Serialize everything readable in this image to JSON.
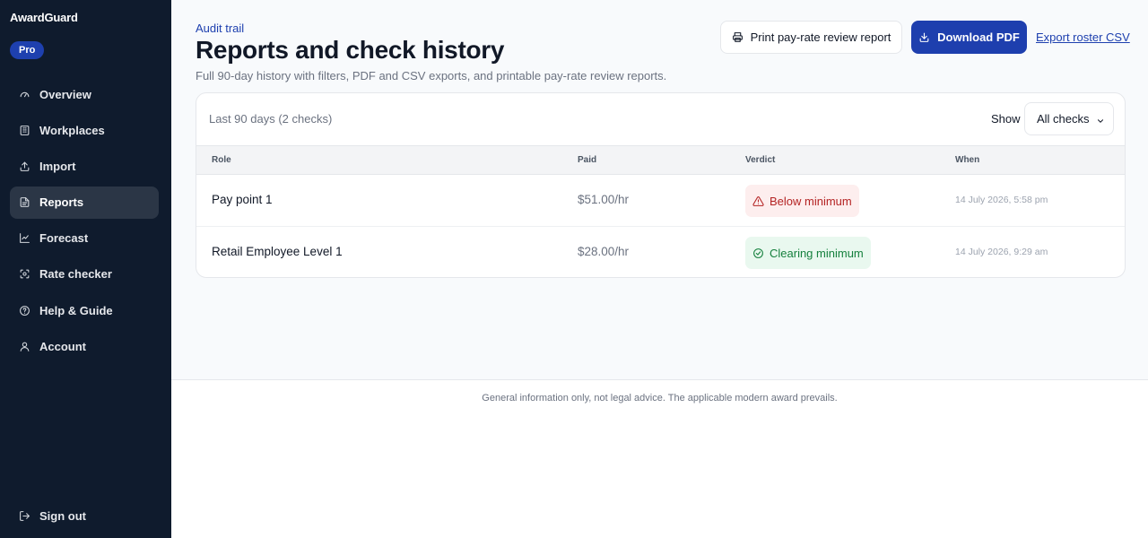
{
  "app": {
    "brand": "AwardGuard",
    "plan": "Pro"
  },
  "sidebar": {
    "items": [
      {
        "label": "Overview",
        "icon": "gauge-icon",
        "active": false
      },
      {
        "label": "Workplaces",
        "icon": "building-icon",
        "active": false
      },
      {
        "label": "Import",
        "icon": "upload-icon",
        "active": false
      },
      {
        "label": "Reports",
        "icon": "document-icon",
        "active": true
      },
      {
        "label": "Forecast",
        "icon": "line-chart-icon",
        "active": false
      },
      {
        "label": "Rate checker",
        "icon": "scan-icon",
        "active": false
      },
      {
        "label": "Help & Guide",
        "icon": "help-circle-icon",
        "active": false
      },
      {
        "label": "Account",
        "icon": "user-icon",
        "active": false
      }
    ],
    "sign_out": "Sign out"
  },
  "header": {
    "eyebrow": "Audit trail",
    "title": "Reports and check history",
    "subtitle": "Full 90-day history with filters, PDF and CSV exports, and printable pay-rate review reports.",
    "print_label": "Print pay-rate review report",
    "pdf_label": "Download PDF",
    "csv_label": "Export roster CSV"
  },
  "filters": {
    "range_label": "Last 90 days (2 checks)",
    "show_label": "Show",
    "selected": "All checks"
  },
  "table": {
    "columns": [
      "Role",
      "Paid",
      "Verdict",
      "When"
    ],
    "rows": [
      {
        "role": "Pay point 1",
        "paid": "$51.00/hr",
        "verdict": "Below minimum",
        "status": "bad",
        "when": "14 July 2026, 5:58 pm"
      },
      {
        "role": "Retail Employee Level 1",
        "paid": "$28.00/hr",
        "verdict": "Clearing minimum",
        "status": "good",
        "when": "14 July 2026, 9:29 am"
      }
    ]
  },
  "footer": {
    "disclaimer": "General information only, not legal advice. The applicable modern award prevails."
  },
  "colors": {
    "sidebar_bg": "#0f1b2d",
    "accent": "#1e3fae",
    "danger": "#b42323",
    "success": "#15803d"
  }
}
